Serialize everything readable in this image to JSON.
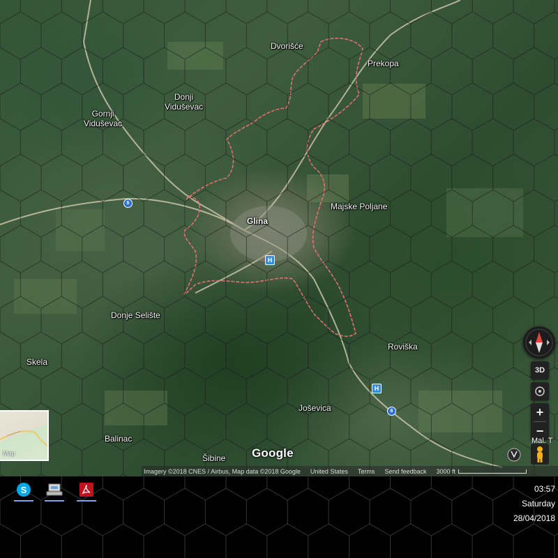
{
  "map": {
    "provider_logo": "Google",
    "attribution": "Imagery ©2018 CNES / Airbus, Map data ©2018 Google",
    "country": "United States",
    "terms": "Terms",
    "feedback": "Send feedback",
    "scale": "3000 ft",
    "minimap_label": "Map",
    "controls": {
      "view_3d": "3D",
      "zoom_in": "+",
      "zoom_out": "−",
      "edge_label": "Mal. T"
    },
    "places": [
      {
        "name": "Dvorišće"
      },
      {
        "name": "Prekopa"
      },
      {
        "name": "Donji\nVidušev ac"
      },
      {
        "name": "Gornji\nVidušev ac"
      },
      {
        "name": "Glina"
      },
      {
        "name": "Majske Poljane"
      },
      {
        "name": "Donje Selište"
      },
      {
        "name": "Roviška"
      },
      {
        "name": "Skela"
      },
      {
        "name": "Joševica"
      },
      {
        "name": "Balinac"
      },
      {
        "name": "Šibine"
      }
    ],
    "road_shields": [
      "6",
      "6"
    ],
    "colors": {
      "boundary": "#e07070",
      "hex_grid": "#1a1a1a",
      "roads": "#c9c3a8"
    }
  },
  "taskbar": {
    "apps": [
      {
        "name": "skype-icon"
      },
      {
        "name": "network-drive-icon"
      },
      {
        "name": "acrobat-icon"
      }
    ],
    "clock": {
      "time": "03:57",
      "day": "Saturday",
      "date": "28/04/2018"
    }
  }
}
